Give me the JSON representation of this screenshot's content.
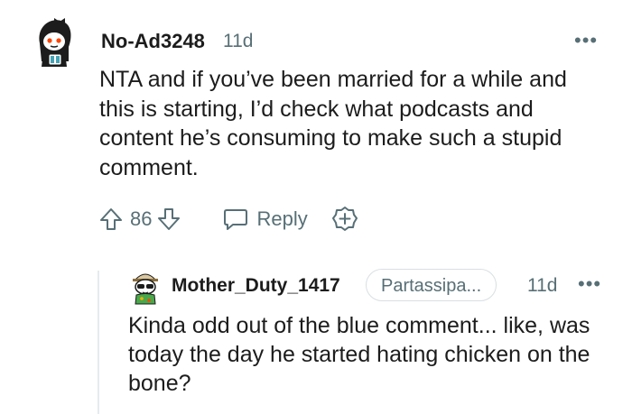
{
  "comment": {
    "username": "No-Ad3248",
    "age": "11d",
    "more_label": "•••",
    "body": "NTA and if you’ve been married for a while and this is starting, I’d check what podcasts and content he’s consuming to make such a stupid comment.",
    "score": "86",
    "reply_label": "Reply",
    "icons": [
      "avatar-icon",
      "upvote-icon",
      "downvote-icon",
      "reply-icon",
      "award-icon",
      "more-icon"
    ]
  },
  "reply": {
    "username": "Mother_Duty_1417",
    "flair": "Partassipa...",
    "age": "11d",
    "more_label": "•••",
    "body": "Kinda odd out of the blue comment... like, was today the day he started hating chicken on the bone?"
  },
  "colors": {
    "text": "#1c1c1c",
    "meta": "#576f76",
    "thread_line": "#e5ebee",
    "avatar_accent": "#ff4500"
  }
}
